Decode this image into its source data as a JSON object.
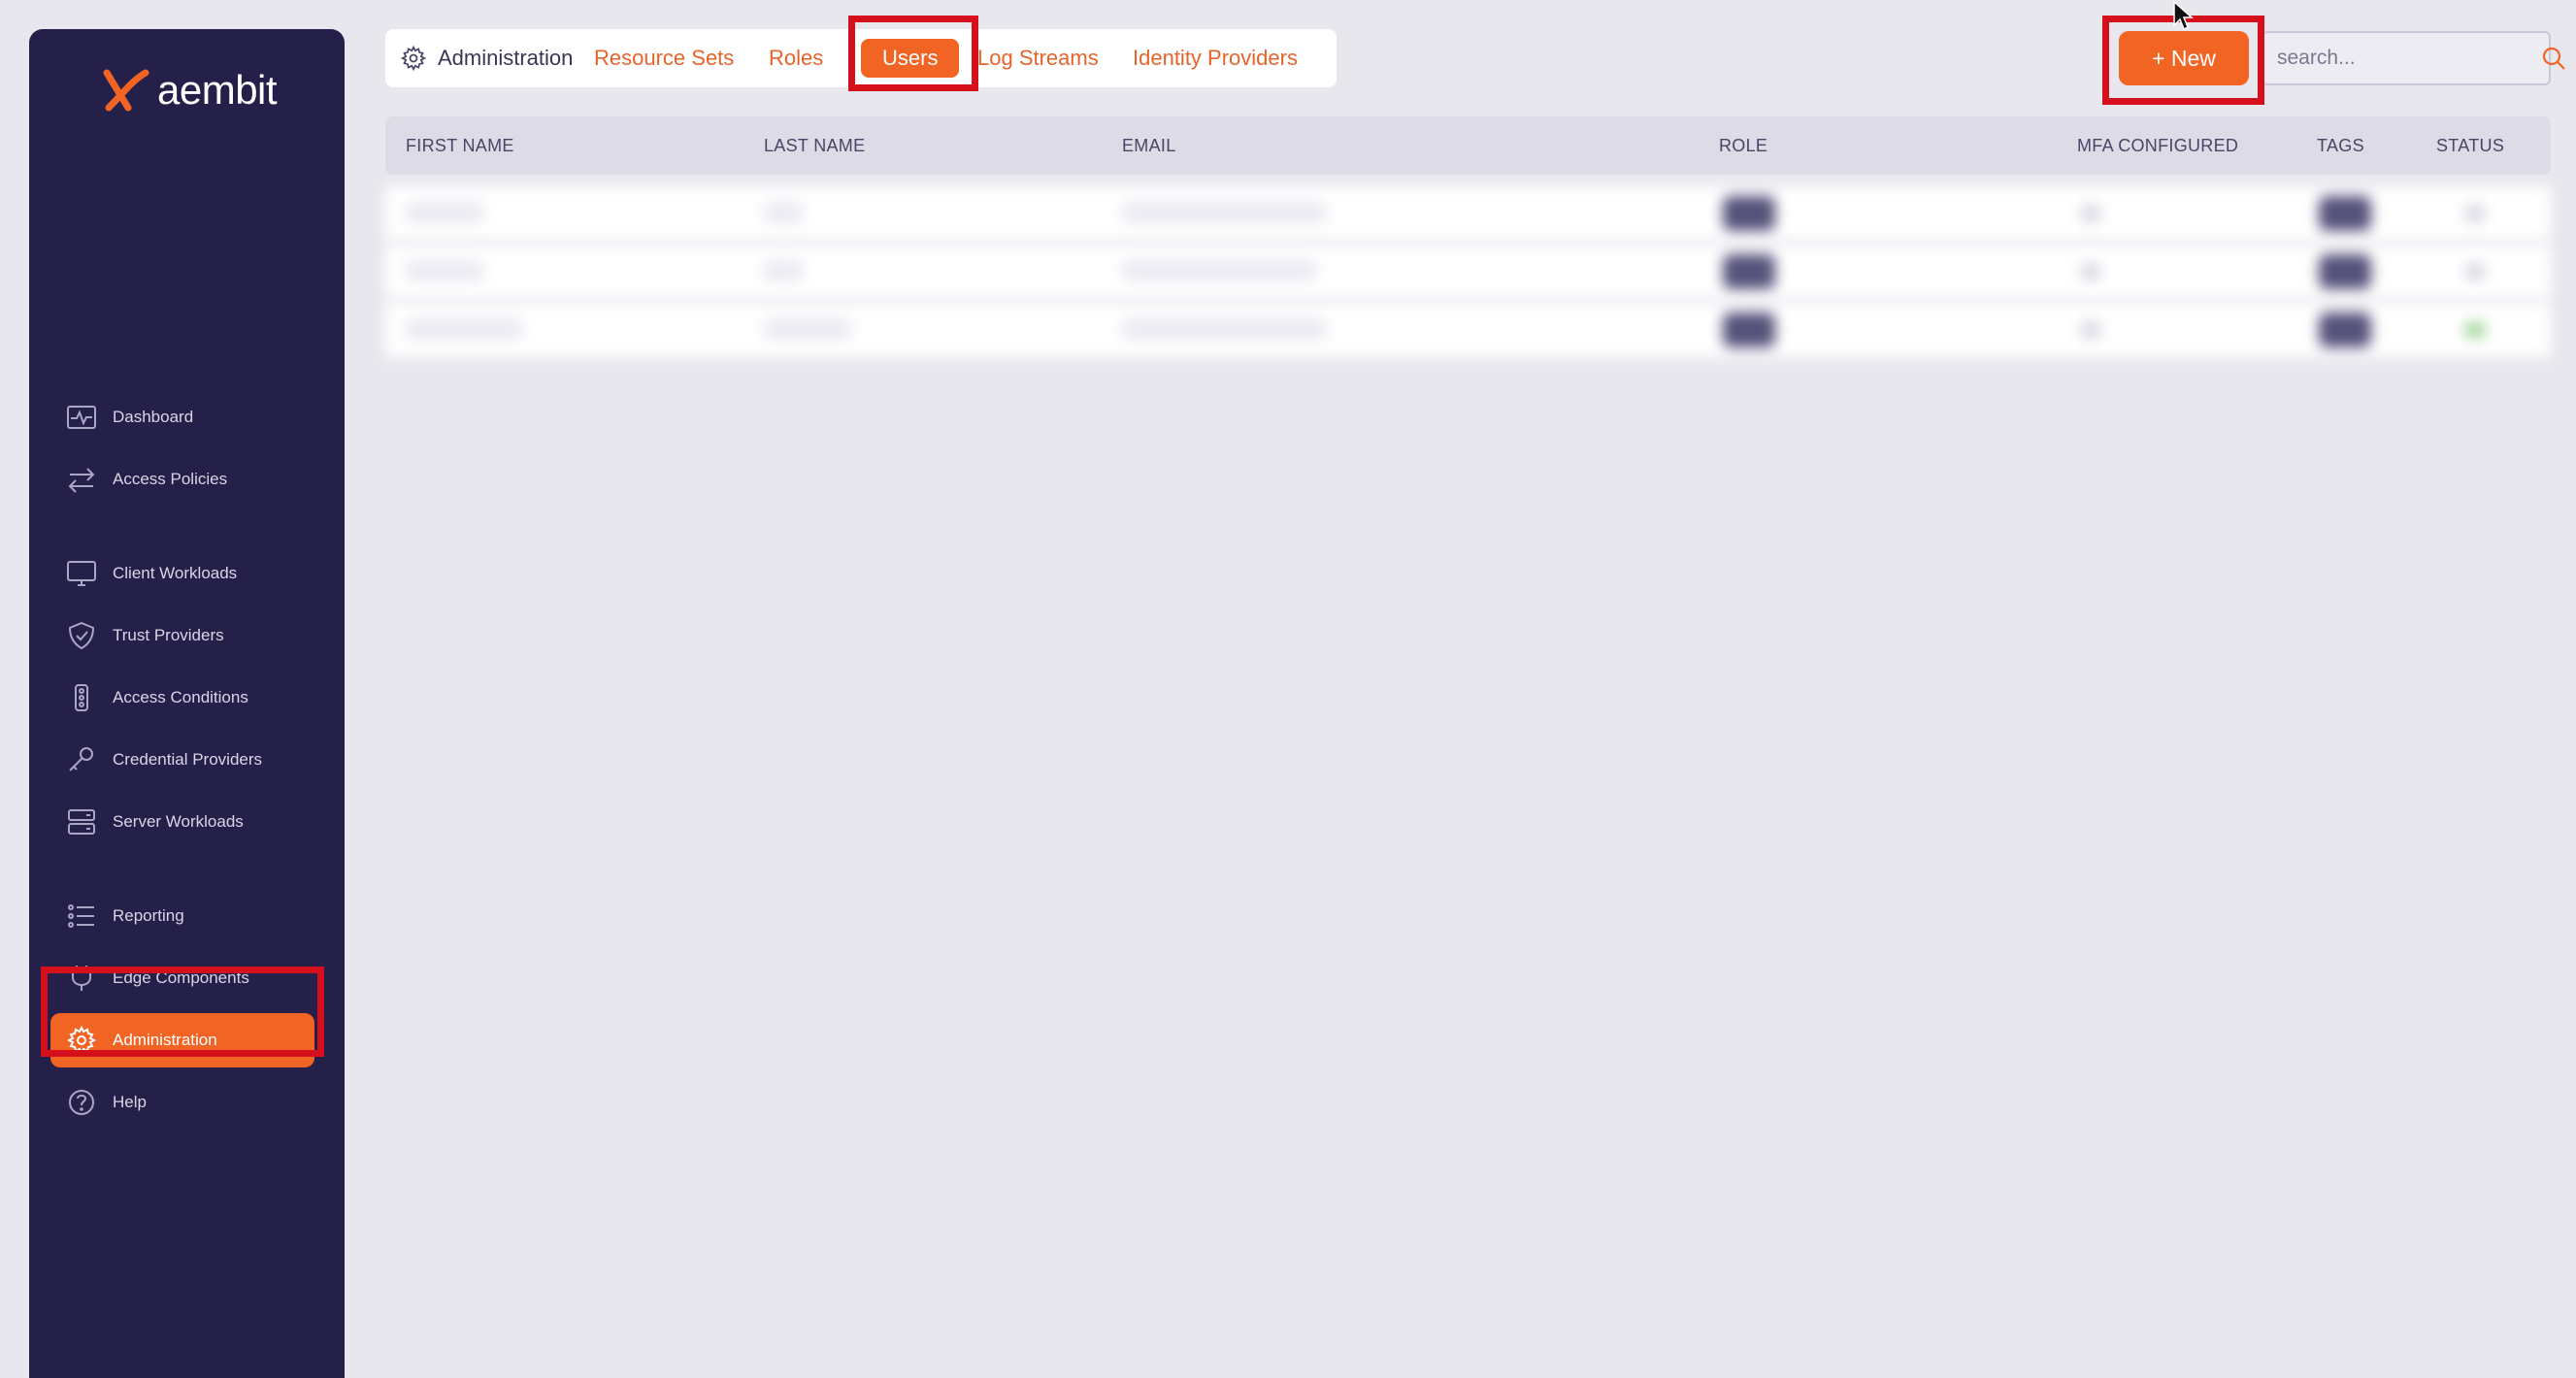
{
  "brand": {
    "name": "aembit",
    "accent": "#f26424",
    "sidebar_bg": "#25204a",
    "highlight": "#d50f1c"
  },
  "sidebar": {
    "items": [
      {
        "label": "Dashboard",
        "icon": "activity-icon"
      },
      {
        "label": "Access Policies",
        "icon": "arrows-swap-icon"
      },
      {
        "label": "Client Workloads",
        "icon": "monitor-icon"
      },
      {
        "label": "Trust Providers",
        "icon": "shield-check-icon"
      },
      {
        "label": "Access Conditions",
        "icon": "traffic-light-icon"
      },
      {
        "label": "Credential Providers",
        "icon": "key-icon"
      },
      {
        "label": "Server Workloads",
        "icon": "server-icon"
      },
      {
        "label": "Reporting",
        "icon": "list-icon"
      },
      {
        "label": "Edge Components",
        "icon": "plug-icon"
      },
      {
        "label": "Administration",
        "icon": "gear-icon",
        "active": true
      },
      {
        "label": "Help",
        "icon": "help-circle-icon"
      }
    ]
  },
  "header": {
    "breadcrumb": "Administration",
    "tabs": [
      {
        "label": "Resource Sets"
      },
      {
        "label": "Roles"
      },
      {
        "label": "Users",
        "active": true
      },
      {
        "label": "Log Streams"
      },
      {
        "label": "Identity Providers"
      }
    ],
    "new_button": "+ New",
    "search_placeholder": "search..."
  },
  "table": {
    "columns": [
      "FIRST NAME",
      "LAST NAME",
      "EMAIL",
      "ROLE",
      "MFA CONFIGURED",
      "TAGS",
      "STATUS"
    ],
    "rows": [
      {
        "first": "",
        "last": "",
        "email": "",
        "status_color": "#d6d4e0"
      },
      {
        "first": "",
        "last": "",
        "email": "",
        "status_color": "#d6d4e0"
      },
      {
        "first": "",
        "last": "",
        "email": "",
        "status_color": "#9fd49a"
      }
    ]
  }
}
